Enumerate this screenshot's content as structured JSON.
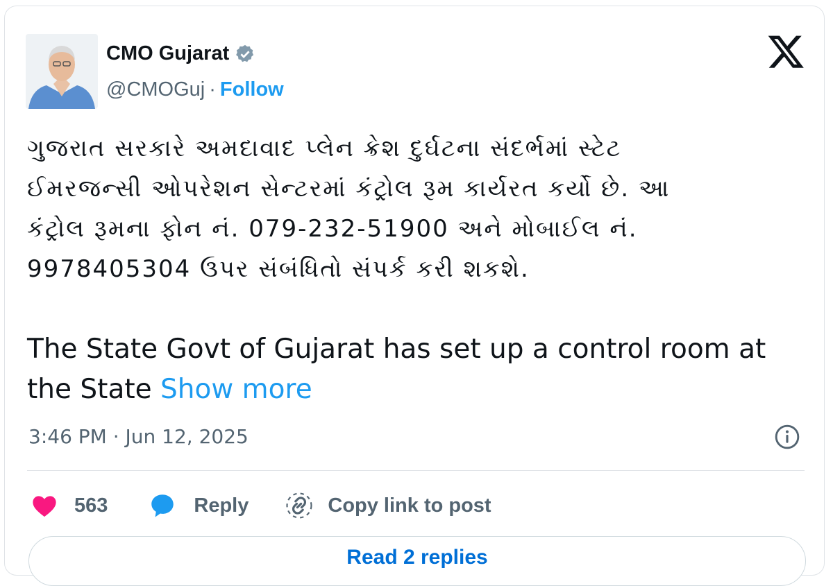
{
  "author": {
    "name": "CMO Gujarat",
    "handle": "@CMOGuj",
    "separator": "·",
    "follow_label": "Follow"
  },
  "tweet": {
    "gujarati_lines": [
      "ગુજરાત સરકારે અમદાવાદ પ્લેન ક્રેશ દુર્ઘટના સંદર્ભમાં સ્ટેટ",
      "ઈમરજન્સી ઓપરેશન સેન્ટરમાં કંટ્રોલ રૂમ કાર્યરત કર્યો છે. આ",
      "કંટ્રોલ રૂમના ફોન નં. 079-232-51900 અને મોબાઈલ નં.",
      "9978405304 ઉપર સંબંધિતો સંપર્ક કરી શકશે."
    ],
    "english_text": "The State Govt of Gujarat has set up a control room at the State",
    "show_more_label": "Show more",
    "timestamp": "3:46 PM · Jun 12, 2025"
  },
  "actions": {
    "like_count": "563",
    "reply_label": "Reply",
    "copy_link_label": "Copy link to post"
  },
  "read_replies_label": "Read 2 replies",
  "colors": {
    "accent": "#1d9bf0",
    "like": "#f91880",
    "muted": "#536471",
    "text": "#0f1419"
  },
  "icons": [
    "verified-badge-icon",
    "x-logo-icon",
    "info-icon",
    "heart-icon",
    "reply-bubble-icon",
    "link-icon"
  ]
}
